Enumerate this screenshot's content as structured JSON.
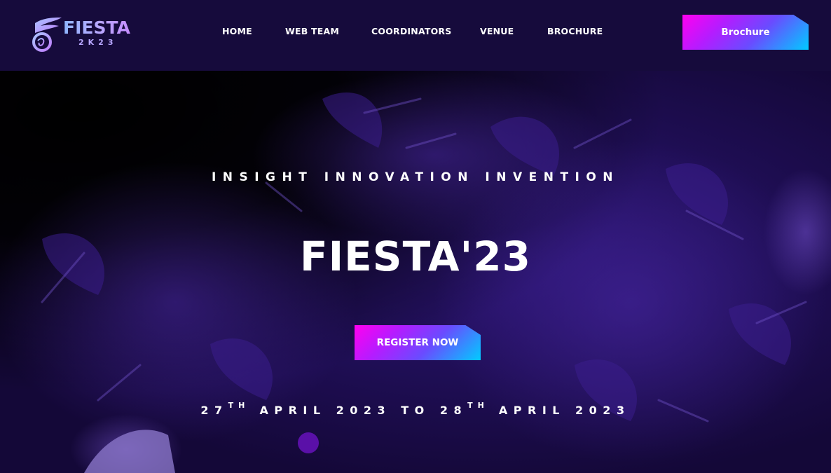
{
  "nav": {
    "logo_text": "FIESTA",
    "logo_sub": "2K23",
    "links": [
      "HOME",
      "WEB TEAM",
      "COORDINATORS",
      "VENUE",
      "BROCHURE"
    ],
    "brochure_button": "Brochure"
  },
  "hero": {
    "tagline": "INSIGHT INNOVATION INVENTION",
    "title": "FIESTA'23",
    "register_button": "REGISTER NOW",
    "dates": {
      "start_day": "27",
      "start_suffix": "TH",
      "start_rest": "APRIL 2023",
      "to": "TO",
      "end_day": "28",
      "end_suffix": "TH",
      "end_rest": "APRIL 2023"
    }
  },
  "colors": {
    "nav_bg": "#160b3c",
    "hero_bg": "#1f0e55",
    "gradient_start": "#ff00f0",
    "gradient_end": "#00ccff",
    "dot": "#5a10a8"
  },
  "icons": [
    "fiesta-logo-icon",
    "carousel-dot-icon"
  ]
}
